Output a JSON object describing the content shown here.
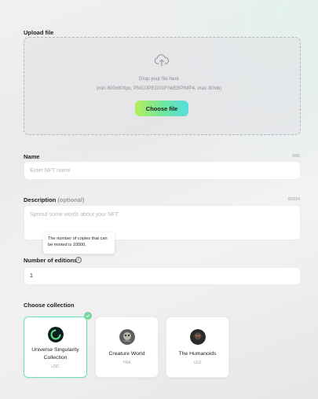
{
  "upload": {
    "label": "Upload file",
    "drop_text": "Drop your file here",
    "requirements": "(min 800x800px, PNG/JPEG/GIF/WEBP/MP4, max 30mb)",
    "button_label": "Choose file"
  },
  "name_field": {
    "label": "Name",
    "counter": "0/60",
    "placeholder": "Enter NFT name",
    "value": ""
  },
  "description_field": {
    "label": "Description",
    "optional": "(optional)",
    "counter": "0/1024",
    "placeholder": "Spread some words about your NFT",
    "value": ""
  },
  "editions": {
    "tooltip": "The number of copies that can be minted is 10000.",
    "label": "Number of editions",
    "value": "1"
  },
  "collections": {
    "label": "Choose collection",
    "items": [
      {
        "name": "Universe Singularity Collection",
        "symbol": "USC",
        "selected": true
      },
      {
        "name": "Creature World",
        "symbol": "YRA",
        "selected": false
      },
      {
        "name": "The Humanoids",
        "symbol": "LEO",
        "selected": false
      }
    ]
  },
  "colors": {
    "accent_gradient_start": "#b3ee5c",
    "accent_gradient_end": "#57dde0",
    "selected_border": "#6fe3b7",
    "check_badge": "#78d79a"
  },
  "icons": {
    "upload": "cloud-upload-icon",
    "info": "info-icon",
    "check": "check-icon"
  }
}
